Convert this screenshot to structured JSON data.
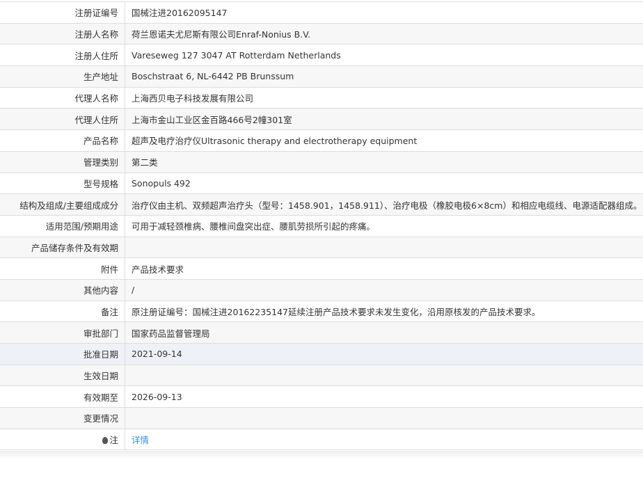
{
  "rows": [
    {
      "label": "注册证编号",
      "value": "国械注进20162095147"
    },
    {
      "label": "注册人名称",
      "value": "荷兰恩诺夫尤尼斯有限公司Enraf-Nonius B.V."
    },
    {
      "label": "注册人住所",
      "value": "Vareseweg 127 3047 AT Rotterdam Netherlands"
    },
    {
      "label": "生产地址",
      "value": "Boschstraat 6, NL-6442 PB Brunssum"
    },
    {
      "label": "代理人名称",
      "value": "上海西贝电子科技发展有限公司"
    },
    {
      "label": "代理人住所",
      "value": "上海市金山工业区金百路466号2幢301室"
    },
    {
      "label": "产品名称",
      "value": "超声及电疗治疗仪Ultrasonic therapy and electrotherapy equipment"
    },
    {
      "label": "管理类别",
      "value": "第二类"
    },
    {
      "label": "型号规格",
      "value": "Sonopuls 492"
    },
    {
      "label": "结构及组成/主要组成成分",
      "value": "治疗仪由主机、双频超声治疗头（型号：1458.901，1458.911）、治疗电极（橡胶电极6×8cm）和相应电缆线、电源适配器组成。"
    },
    {
      "label": "适用范围/预期用途",
      "value": "可用于减轻颈椎病、腰椎间盘突出症、腰肌劳损所引起的疼痛。"
    },
    {
      "label": "产品储存条件及有效期",
      "value": ""
    },
    {
      "label": "附件",
      "value": "产品技术要求"
    },
    {
      "label": "其他内容",
      "value": "/"
    },
    {
      "label": "备注",
      "value": "原注册证编号：国械注进20162235147延续注册产品技术要求未发生变化，沿用原核发的产品技术要求。"
    },
    {
      "label": "审批部门",
      "value": "国家药品监督管理局"
    },
    {
      "label": "批准日期",
      "value": "2021-09-14"
    },
    {
      "label": "生效日期",
      "value": ""
    },
    {
      "label": "有效期至",
      "value": "2026-09-13"
    },
    {
      "label": "变更情况",
      "value": ""
    }
  ],
  "note": {
    "label": "注",
    "link": "详情",
    "icon": "lightbulb-icon"
  },
  "highlight_row": 16
}
